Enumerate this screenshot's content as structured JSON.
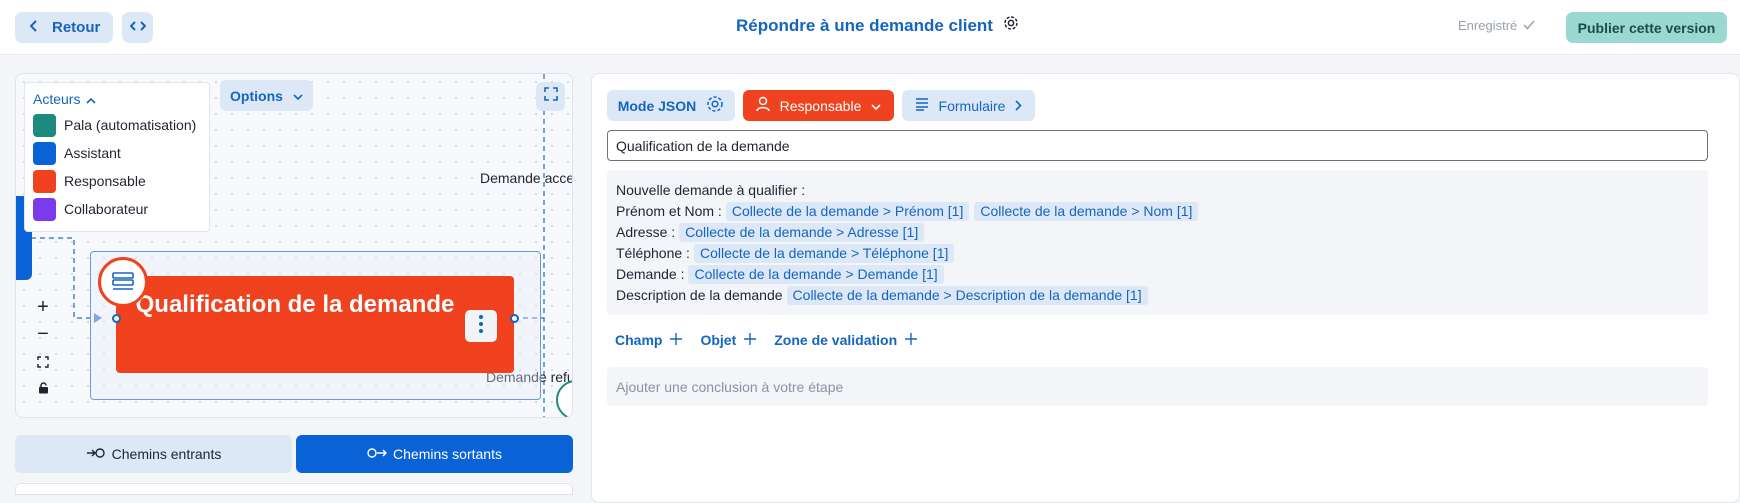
{
  "header": {
    "back_label": "Retour",
    "title": "Répondre à une demande client",
    "saved_label": "Enregistré",
    "publish_label": "Publier cette version"
  },
  "canvas": {
    "legend": {
      "title": "Acteurs",
      "actors": [
        {
          "label": "Pala (automatisation)",
          "color": "#1e8a7e"
        },
        {
          "label": "Assistant",
          "color": "#0a63d6"
        },
        {
          "label": "Responsable",
          "color": "#f0421f"
        },
        {
          "label": "Collaborateur",
          "color": "#7c3aed"
        }
      ]
    },
    "options_label": "Options",
    "edge_labels": [
      "Demande acce",
      "Demande refu"
    ],
    "node": {
      "title": "Qualification de la demande",
      "color": "#f0421f"
    },
    "zoom_in": "+",
    "zoom_out": "−"
  },
  "path_tabs": {
    "incoming": "Chemins entrants",
    "outgoing": "Chemins sortants"
  },
  "editor": {
    "json_mode_label": "Mode JSON",
    "actor_label": "Responsable",
    "form_label": "Formulaire",
    "step_title": "Qualification de la demande",
    "content": {
      "intro": "Nouvelle demande à qualifier :",
      "lines": [
        {
          "label": "Prénom et Nom :",
          "chips": [
            "Collecte de la demande > Prénom [1]",
            "Collecte de la demande > Nom [1]"
          ]
        },
        {
          "label": "Adresse :",
          "chips": [
            "Collecte de la demande > Adresse [1]"
          ]
        },
        {
          "label": "Téléphone :",
          "chips": [
            "Collecte de la demande > Téléphone [1]"
          ]
        },
        {
          "label": "Demande :",
          "chips": [
            "Collecte de la demande > Demande [1]"
          ]
        },
        {
          "label": "Description de la demande",
          "chips": [
            "Collecte de la demande > Description de la demande [1]"
          ]
        }
      ]
    },
    "add_items": [
      "Champ",
      "Objet",
      "Zone de validation"
    ],
    "conclusion_placeholder": "Ajouter une conclusion à votre étape"
  }
}
